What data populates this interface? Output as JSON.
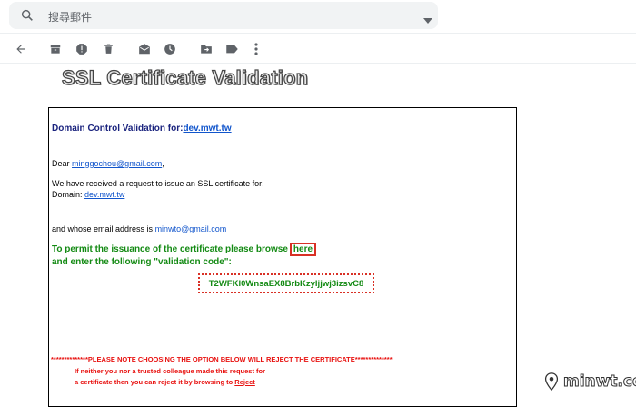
{
  "search": {
    "placeholder": "搜尋郵件"
  },
  "toolbar": {
    "icons": [
      "back-arrow-icon",
      "archive-icon",
      "report-spam-icon",
      "delete-icon",
      "mark-unread-icon",
      "snooze-icon",
      "move-to-icon",
      "labels-icon",
      "more-vert-icon"
    ]
  },
  "email": {
    "banner_title": "SSL Certificate Validation",
    "domain_heading": "Domain Control Validation for:",
    "domain_link": "dev.mwt.tw",
    "greeting_prefix": "Dear ",
    "greeting_email": "minggochou@gmail.com",
    "greeting_suffix": ",",
    "request_line": "We have received a request to issue an SSL certificate for:",
    "domain_label": "Domain: ",
    "domain_value": "dev.mwt.tw",
    "address_prefix": " and whose email address is ",
    "address_email": "minwto@gmail.com",
    "permit_line": "To permit the issuance of the certificate please browse",
    "here_link": "here",
    "enter_line": "and enter the following \"validation code\":",
    "validation_code": "T2WFKl0WnsaEX8BrbKzyljjwj3izsvC8",
    "warning_line": "**************PLEASE NOTE CHOOSING THE OPTION BELOW WILL REJECT THE CERTIFICATE**************",
    "reject_line1": "If neither you nor a trusted colleague made this request for",
    "reject_line2_prefix": "a certificate then you can reject it by browsing to ",
    "reject_link": "Reject"
  },
  "watermark": {
    "text": "minwt.com"
  }
}
